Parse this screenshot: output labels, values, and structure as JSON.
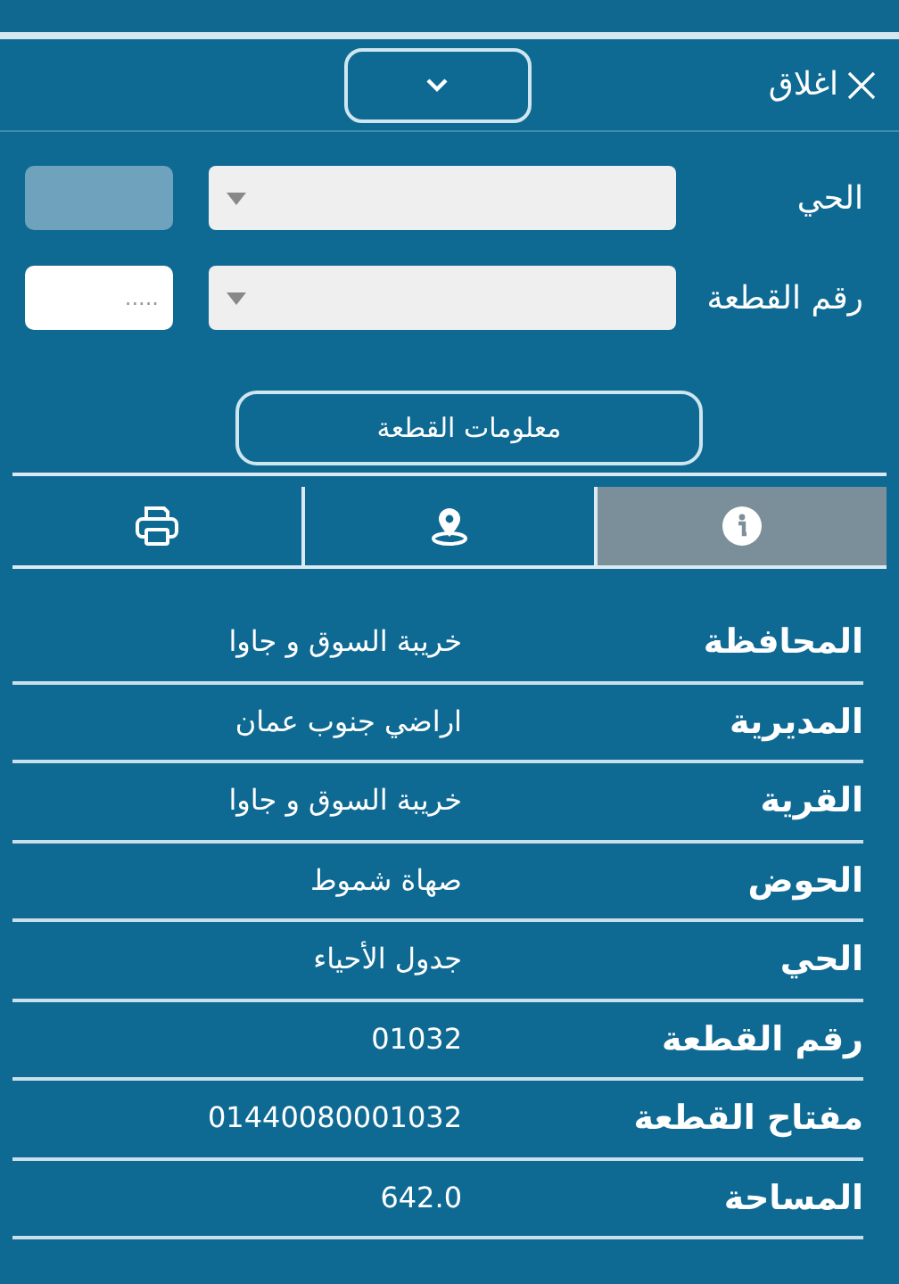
{
  "header": {
    "close_label": "اغلاق"
  },
  "filters": [
    {
      "label": "الحي",
      "disabled": true
    },
    {
      "label": "رقم القطعة",
      "disabled": false,
      "placeholder": "....."
    }
  ],
  "info_button": "معلومات القطعة",
  "tabs": [
    {
      "kind": "info",
      "selected": true
    },
    {
      "kind": "location",
      "selected": false
    },
    {
      "kind": "print",
      "selected": false
    }
  ],
  "details": [
    {
      "label": "المحافظة",
      "value": "خريبة السوق و جاوا"
    },
    {
      "label": "المديرية",
      "value": "اراضي جنوب عمان"
    },
    {
      "label": "القرية",
      "value": "خريبة السوق و جاوا"
    },
    {
      "label": "الحوض",
      "value": "صهاة شموط"
    },
    {
      "label": "الحي",
      "value": "جدول الأحياء"
    },
    {
      "label": "رقم القطعة",
      "value": "01032"
    },
    {
      "label": "مفتاح القطعة",
      "value": "01440080001032"
    },
    {
      "label": "المساحة",
      "value": "642.0"
    }
  ]
}
